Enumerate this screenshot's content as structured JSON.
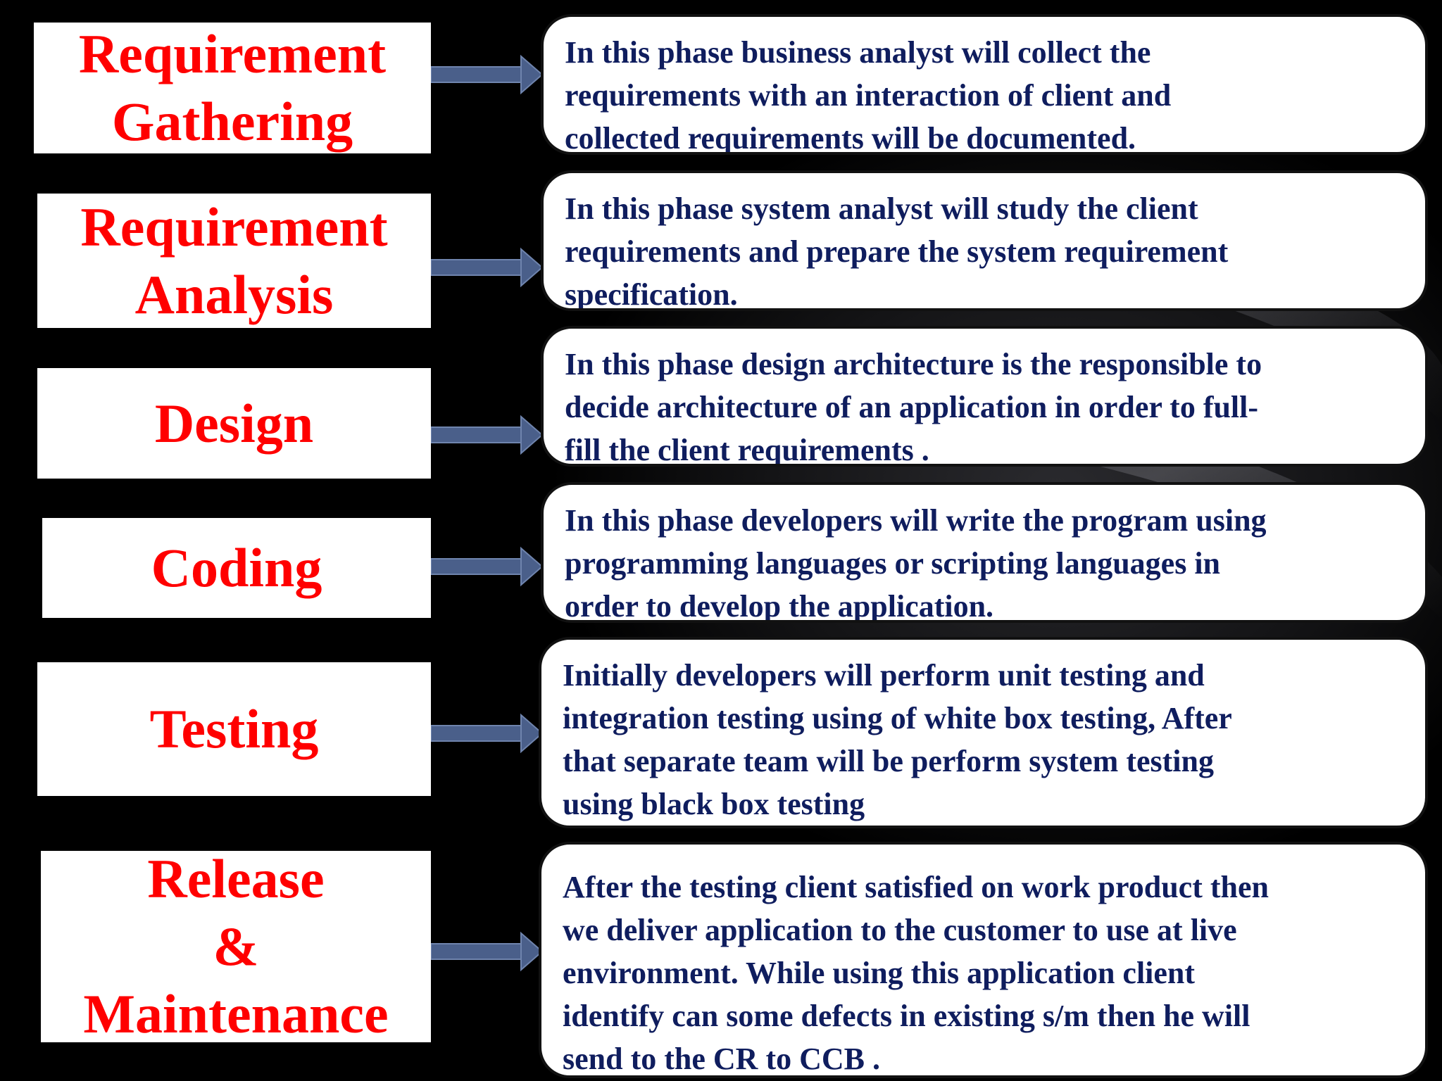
{
  "colors": {
    "background": "#000000",
    "phase_box": "#ffffff",
    "phase_text": "#ff0000",
    "description_text": "#0f1d5e",
    "arrow": "#4a5f8a"
  },
  "phases": [
    {
      "title_lines": [
        "Requirement",
        "Gathering"
      ],
      "description": "In this phase business analyst will collect the\nrequirements with an interaction of client and\ncollected requirements will be documented."
    },
    {
      "title_lines": [
        "Requirement",
        "Analysis"
      ],
      "description": "In this phase system analyst will study the client\nrequirements and prepare the system requirement\nspecification."
    },
    {
      "title_lines": [
        "Design"
      ],
      "description": "In this phase design architecture is the responsible to\ndecide architecture of an application in order to full-\nfill the client requirements ."
    },
    {
      "title_lines": [
        "Coding"
      ],
      "description": "In this phase developers will write the program using\nprogramming languages or scripting languages in\norder to develop the application."
    },
    {
      "title_lines": [
        "Testing"
      ],
      "description": "Initially developers will perform unit testing and\nintegration testing using of white box testing, After\nthat separate team will be perform system testing\nusing black box testing"
    },
    {
      "title_lines": [
        "Release",
        "&",
        "Maintenance"
      ],
      "description": "After the testing client satisfied on work product then\nwe deliver application to the customer to use at live\nenvironment. While using this application client\nidentify can some defects in existing s/m then he will\nsend to the CR to CCB ."
    }
  ]
}
